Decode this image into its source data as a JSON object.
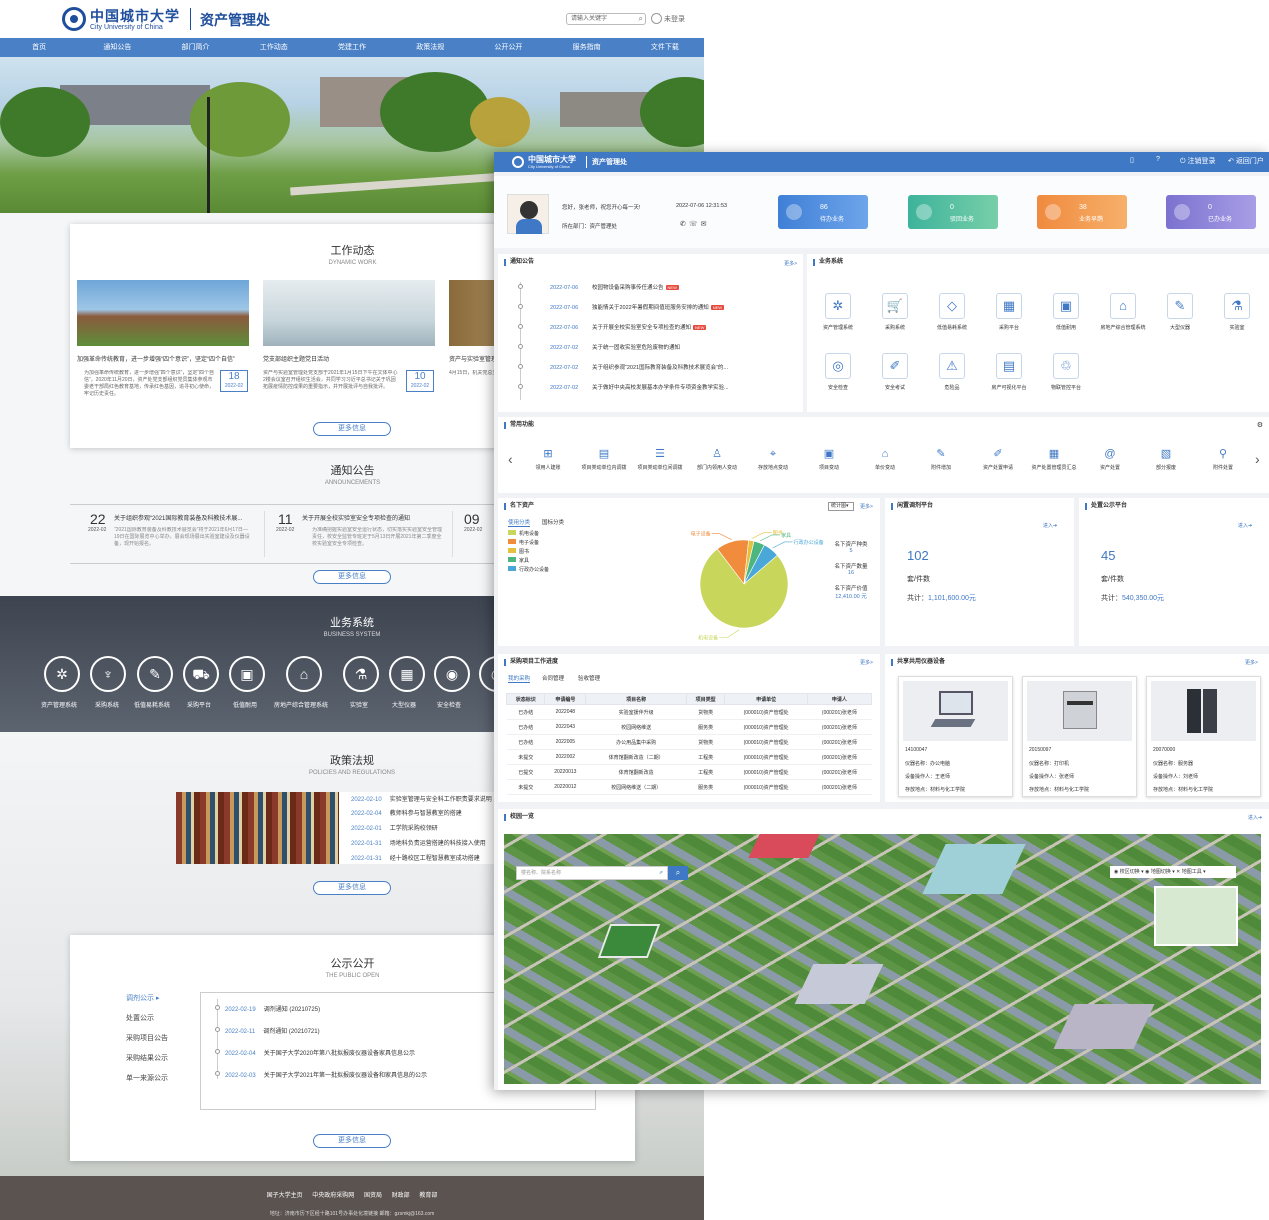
{
  "portal": {
    "school_cn": "中国城市大学",
    "school_en": "City University of China",
    "dept": "资产管理处",
    "search_placeholder": "请输入关键字",
    "login": "未登录",
    "nav": [
      "首页",
      "通知公告",
      "部门简介",
      "工作动态",
      "党建工作",
      "政策法规",
      "公开公开",
      "服务指南",
      "文件下载"
    ],
    "work": {
      "title": "工作动态",
      "subtitle": "DYNAMIC WORK",
      "items": [
        {
          "title": "加强革命传统教育，进一步增强“四个意识”，坚定“四个自信”",
          "body": "为加强革命传统教育，进一步增强“四个意识”，坚定“四个自信”，2020年11月20日，资产处党支部组织党员集体参观市委老干部局红色教育基地，传承红色基因，追寻初心使命，牢记历史责任。",
          "day": "18",
          "ym": "2022-02"
        },
        {
          "title": "党支部组织主题党日活动",
          "body": "资产与实验室管理处党支部于2021年1月15日下午在文体中心2楼会议室召开组织生活会，共同学习习近平总书记关于巩固拓展疫情防控成果的重要指示，并开展批评与自我批评。",
          "day": "10",
          "ym": "2022-02"
        },
        {
          "title": "资产与实验室管理",
          "body": "4月15日，机关党总支组织开展第二十二次主题党日活动，以实验室安全为主题。"
        }
      ],
      "more": "更多信息"
    },
    "ann": {
      "title": "通知公告",
      "subtitle": "ANNOUNCEMENTS",
      "items": [
        {
          "day": "22",
          "ym": "2022-02",
          "title": "关于组织参观“2021国际教育装备及科教技术展...",
          "body": "“2021国际教育装备及科教技术展览会”将于2021年6月17日—19日在国际展览中心举办，展会现场展出实验室建设及仪器设备，现开始报名。"
        },
        {
          "day": "11",
          "ym": "2022-02",
          "title": "关于开展全校实验室安全专项检查的通知",
          "body": "为准确把握实验室安全运行状态，切实落实实验室安全管理责任，校安全监管专班定于5月13日开展2021年第二季度全校实验室安全专项检查。"
        },
        {
          "day": "09",
          "ym": "2022-02"
        }
      ],
      "more": "更多信息"
    },
    "biz": {
      "title": "业务系统",
      "subtitle": "BUSINESS SYSTEM",
      "items": [
        "资产管理系统",
        "采购系统",
        "低值易耗系统",
        "采购平台",
        "低值耐用",
        "房地产综合管理系统",
        "实验室",
        "大型仪器",
        "安全检查"
      ]
    },
    "policy": {
      "title": "政策法规",
      "subtitle": "POLICIES AND REGULATIONS",
      "items": [
        {
          "date": "2022-02-10",
          "title": "实验室管理与安全科工作职责要求说明"
        },
        {
          "date": "2022-02-04",
          "title": "教师科参与智慧教室的搭建"
        },
        {
          "date": "2022-02-01",
          "title": "工学院采购校领研"
        },
        {
          "date": "2022-01-31",
          "title": "场地科负责运营搭建的科技接入使用"
        },
        {
          "date": "2022-01-31",
          "title": "经十路校区工程智慧教室成功搭建"
        }
      ],
      "more": "更多信息"
    },
    "open": {
      "title": "公示公开",
      "subtitle": "THE PUBLIC OPEN",
      "cats": [
        "调剂公示",
        "处置公示",
        "采购项目公告",
        "采购结果公示",
        "单一来源公示"
      ],
      "items": [
        {
          "date": "2022-02-19",
          "title": "调剂通知 (20210725)"
        },
        {
          "date": "2022-02-11",
          "title": "调剂通知 (20210721)"
        },
        {
          "date": "2022-02-04",
          "title": "关于国子大学2020年第八批拟报废仪器设备家具信息公示"
        },
        {
          "date": "2022-02-03",
          "title": "关于国子大学2021年第一批拟报废仪器设备和家具信息的公示"
        }
      ],
      "more": "更多信息"
    },
    "footer": {
      "links": [
        "国子大学主页",
        "中央政府采购网",
        "国资局",
        "财政部",
        "教育部"
      ],
      "address": "地址：济南市历下区经十路101号办事处化境链接 邮箱：gzsmkj@163.com"
    }
  },
  "admin": {
    "header": {
      "school_cn": "中国城市大学",
      "school_en": "City University of China",
      "dept": "资产管理处",
      "logout": "注销登录",
      "back": "返回门户"
    },
    "user": {
      "greeting": "您好，张老师，祝您开心每一天!",
      "datetime": "2022-07-06 12:31:53",
      "dept": "所在部门：资产管理处"
    },
    "stats": [
      {
        "num": "86",
        "label": "待办业务",
        "color": "#4f8fe0"
      },
      {
        "num": "0",
        "label": "驳回业务",
        "color": "#4cbfa6"
      },
      {
        "num": "38",
        "label": "业务早鹊",
        "color": "#f29b52"
      },
      {
        "num": "0",
        "label": "已办业务",
        "color": "#8b82d6"
      }
    ],
    "notice": {
      "title": "通知公告",
      "more": "更多>",
      "items": [
        {
          "date": "2022-07-06",
          "title": "校园物设备采购事传任通公告",
          "new": true
        },
        {
          "date": "2022-07-06",
          "title": "独能情关于2022年暑假期间值班服务安排的通知",
          "new": true
        },
        {
          "date": "2022-07-06",
          "title": "关于开展全校实验室安全专项检查的通知",
          "new": true
        },
        {
          "date": "2022-07-02",
          "title": "关于统一固收实验室危险废物的通知",
          "new": false
        },
        {
          "date": "2022-07-02",
          "title": "关于组织参观“2021国际教育装备及科教技术展览会”的...",
          "new": false
        },
        {
          "date": "2022-07-02",
          "title": "关于做好中央高校发展基本办学条件专项资金教学实验...",
          "new": false
        }
      ]
    },
    "systems": {
      "title": "业务系统",
      "items": [
        {
          "label": "资产管理系统",
          "icon": "✲"
        },
        {
          "label": "采购系统",
          "icon": "🛒"
        },
        {
          "label": "低值易耗系统",
          "icon": "◇"
        },
        {
          "label": "采购平台",
          "icon": "▦"
        },
        {
          "label": "低值耐用",
          "icon": "▣"
        },
        {
          "label": "房地产综合管理系统",
          "icon": "⌂"
        },
        {
          "label": "大型仪器",
          "icon": "✎"
        },
        {
          "label": "实验室",
          "icon": "⚗"
        },
        {
          "label": "安全检查",
          "icon": "◎"
        },
        {
          "label": "安全考试",
          "icon": "✐"
        },
        {
          "label": "危险品",
          "icon": "⚠"
        },
        {
          "label": "房产可视化平台",
          "icon": "▤"
        },
        {
          "label": "物联管控平台",
          "icon": "♲"
        }
      ]
    },
    "common": {
      "title": "常用功能",
      "items": [
        "领用人建账",
        "项目类动单位内调拨",
        "项目类动单位间调拨",
        "部门内领用人变动",
        "存放地点变动",
        "项目变动",
        "单价变动",
        "附件增加",
        "资产处置申请",
        "资产处置管理员汇总",
        "资产处置",
        "部分报废",
        "附件处置"
      ]
    },
    "assets": {
      "title": "名下资产",
      "select": "统计图",
      "more": "更多>",
      "tabs": [
        "使用分类",
        "国标分类"
      ],
      "legend": [
        "机电设备",
        "电子设备",
        "图书",
        "家具",
        "行政办公设备"
      ],
      "kinds_label": "名下资产种类",
      "kinds": "5",
      "count_label": "名下资产数量",
      "count": "16",
      "value_label": "名下资产价值",
      "value": "12,410.00 元"
    },
    "idle": {
      "title": "闲置调剂平台",
      "enter": "进入",
      "num": "102",
      "unit": "套/件数",
      "total_label": "共计：",
      "total": "1,101,600.00元"
    },
    "dispose": {
      "title": "处置公示平台",
      "enter": "进入",
      "num": "45",
      "unit": "套/件数",
      "total_label": "共计：",
      "total": "540,350.00元"
    },
    "chart_data": {
      "type": "pie",
      "categories": [
        "机电设备",
        "电子设备",
        "图书",
        "家具",
        "行政办公设备"
      ],
      "values": [
        76,
        12,
        2,
        4,
        6
      ],
      "colors": [
        "#c8d75c",
        "#f08c3c",
        "#e5c13e",
        "#4db57e",
        "#4aa8d8"
      ]
    },
    "purchase": {
      "title": "采购项目工作进度",
      "more": "更多>",
      "tabs": [
        "我的采购",
        "合同管理",
        "验收管理"
      ],
      "columns": [
        "状态标识",
        "申请编号",
        "项目名称",
        "项目类型",
        "申请单位",
        "申请人"
      ],
      "rows": [
        [
          "已办结",
          "2022048",
          "实验室援伴升级",
          "货物类",
          "(000010)资产管理处",
          "(000201)张老师"
        ],
        [
          "已办结",
          "2022043",
          "校园网络维送",
          "服务类",
          "(000010)资产管理处",
          "(000201)张老师"
        ],
        [
          "已办结",
          "2022005",
          "办公用品集中采购",
          "货物类",
          "(000010)资产管理处",
          "(000201)张老师"
        ],
        [
          "未提交",
          "2022002",
          "体育馆翻新改造（二期）",
          "工程类",
          "(000010)资产管理处",
          "(000201)张老师"
        ],
        [
          "已提交",
          "20220013",
          "体育馆翻新改造",
          "工程类",
          "(000010)资产管理处",
          "(000201)张老师"
        ],
        [
          "未提交",
          "20220012",
          "校园网络维送（二期）",
          "服务类",
          "(000010)资产管理处",
          "(000201)张老师"
        ]
      ]
    },
    "equip": {
      "title": "共享共用仪器设备",
      "more": "更多>",
      "items": [
        {
          "code": "14100047",
          "name": "仪器名称：办公电脑",
          "operator": "设备操作人：王老师",
          "location": "存放地点：材料与化工学院"
        },
        {
          "code": "20150097",
          "name": "仪器名称：打印机",
          "operator": "设备操作人：张老师",
          "location": "存放地点：材料与化工学院"
        },
        {
          "code": "20070000",
          "name": "仪器名称：服务器",
          "operator": "设备操作人：刘老师",
          "location": "存放地点：材料与化工学院"
        }
      ]
    },
    "campus": {
      "title": "校园一览",
      "enter": "进入",
      "search_placeholder": "楼名称、院系名称",
      "switch_campus": "校区切换",
      "switch_map": "地图切换",
      "tools": "地图工具"
    }
  }
}
